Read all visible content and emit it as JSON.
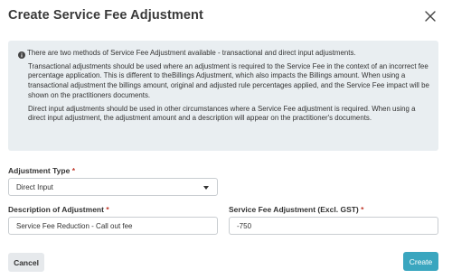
{
  "modal": {
    "title": "Create Service Fee Adjustment",
    "close_icon": "close-icon"
  },
  "info": {
    "icon": "info-icon",
    "paragraphs": [
      "There are two methods of Service Fee Adjustment available - transactional and direct input adjustments.",
      "Transactional adjustments should be used where an adjustment is required to the Service Fee in the context of an incorrect fee percentage application. This is different to theBillings Adjustment, which also impacts the Billings amount. When using a transactional adjustment the billings amount, original and adjusted rule percentages applied, and the Service Fee impact will be shown on the practitioners documents.",
      "Direct input adjustments should be used in other circumstances where a Service Fee adjustment is required. When using a direct input adjustment, the adjustment amount and a description will appear on the practitioner's documents."
    ]
  },
  "form": {
    "adjustment_type": {
      "label": "Adjustment Type",
      "required_mark": "*",
      "value": "Direct Input"
    },
    "description": {
      "label": "Description of Adjustment",
      "required_mark": "*",
      "value": "Service Fee Reduction - Call out fee"
    },
    "amount": {
      "label": "Service Fee Adjustment (Excl. GST)",
      "required_mark": "*",
      "value": "-750"
    }
  },
  "footer": {
    "cancel_label": "Cancel",
    "create_label": "Create"
  },
  "colors": {
    "primary": "#3aa6bf",
    "info_bg": "#e9eef1",
    "required": "#c0392b"
  }
}
